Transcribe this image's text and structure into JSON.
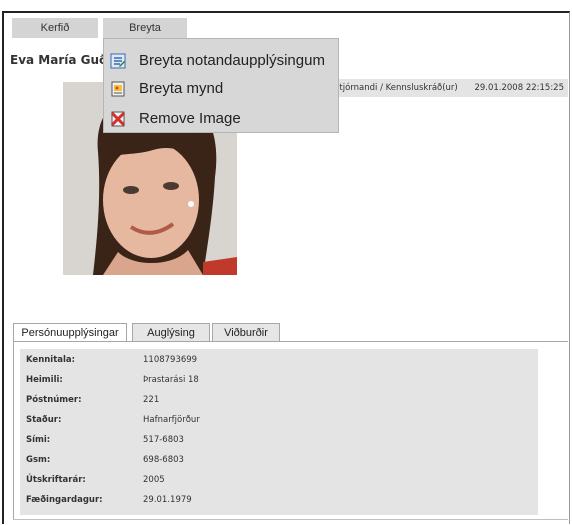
{
  "topbar": {
    "kerfid_label": "Kerfið",
    "breyta_label": "Breyta"
  },
  "profile": {
    "name": "Eva María Guð",
    "role": "Stjórnandi / Kennsluskráð(ur)",
    "date": "29.01.2008 22:15:25"
  },
  "menu": {
    "items": [
      {
        "label": "Breyta notandaupplýsingum",
        "icon": "edit-user-icon"
      },
      {
        "label": "Breyta mynd",
        "icon": "image-edit-icon"
      },
      {
        "label": "Remove Image",
        "icon": "remove-image-icon"
      }
    ]
  },
  "tabs": [
    {
      "label": "Persónuupplýsingar",
      "active": true
    },
    {
      "label": "Auglýsing",
      "active": false
    },
    {
      "label": "Viðburðir",
      "active": false
    }
  ],
  "details": [
    {
      "key": "Kennitala:",
      "value": "1108793699"
    },
    {
      "key": "Heimili:",
      "value": "Þrastarási 18"
    },
    {
      "key": "Póstnúmer:",
      "value": "221"
    },
    {
      "key": "Staður:",
      "value": "Hafnarfjörður"
    },
    {
      "key": "Sími:",
      "value": "517-6803"
    },
    {
      "key": "Gsm:",
      "value": "698-6803"
    },
    {
      "key": "Útskriftarár:",
      "value": "2005"
    },
    {
      "key": "Fæðingardagur:",
      "value": "29.01.1979"
    }
  ]
}
